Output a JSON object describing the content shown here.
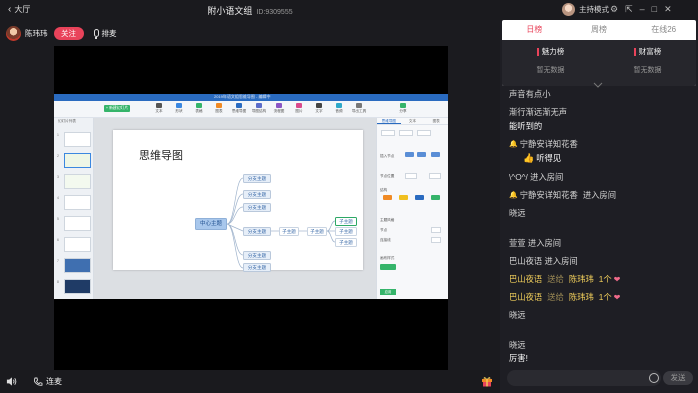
{
  "topbar": {
    "lobby_label": "大厅",
    "room_title": "附小语文组",
    "room_id": "ID:9309555",
    "host_mode_label": "主持模式"
  },
  "anchor": {
    "name": "陈玮玮",
    "follow_label": "关注",
    "mic_queue_label": "排麦"
  },
  "shared_screen": {
    "titlebar_text": "2019年语文组思维导图 - 编辑中",
    "toolbar": [
      "文本",
      "形状",
      "表格",
      "图表",
      "思维导图",
      "导图结构",
      "流程图",
      "图片",
      "文字",
      "音频",
      "导出工具",
      "分享"
    ],
    "new_slide_label": "+ 新建幻灯片",
    "slides_header": "幻灯片列表",
    "slide_numbers": [
      "1",
      "2",
      "3",
      "4",
      "5",
      "6",
      "7",
      "8"
    ],
    "mind_map": {
      "title": "思维导图",
      "center": "中心主题",
      "branches": [
        "分支主题",
        "分支主题",
        "分支主题",
        "分支主题",
        "分支主题",
        "分支主题"
      ],
      "sub_topics": [
        "子主题",
        "子主题",
        "子主题",
        "子主题",
        "子主题"
      ]
    },
    "props_tabs": [
      "思维导图",
      "文本",
      "图表"
    ],
    "props_labels": [
      "插入节点",
      "节点位置",
      "结构",
      "主题风格",
      "节点",
      "连接线",
      "画布样式"
    ],
    "apply_label": "应用"
  },
  "bottombar": {
    "lianmai_label": "连麦"
  },
  "ranking": {
    "tabs": [
      "日榜",
      "周榜",
      "在线26"
    ],
    "active_tab": 0,
    "columns": [
      {
        "title": "魅力榜",
        "empty": "暂无数据"
      },
      {
        "title": "财富榜",
        "empty": "暂无数据"
      }
    ]
  },
  "chat": {
    "messages": [
      {
        "text": "声音有点小",
        "style": "plain"
      },
      {
        "text": "渐行渐远渐无声",
        "style": "plain"
      },
      {
        "text": "能听到的",
        "style": "white"
      },
      {
        "user": "宁静安详知花香",
        "text": "",
        "style": "bell"
      },
      {
        "text": "听得见",
        "style": "thumb"
      },
      {
        "text": "\\^O^/ 进入房间",
        "style": "plain"
      },
      {
        "user": "宁静安详知花香",
        "text": "进入房间",
        "style": "bell"
      },
      {
        "text": "晓远",
        "style": "plain"
      },
      {
        "text": "萱萱 进入房间",
        "style": "plain"
      },
      {
        "text": "巴山夜语 进入房间",
        "style": "plain"
      },
      {
        "user": "巴山夜语",
        "verb": "送给",
        "target": "陈玮玮",
        "count": "1个",
        "style": "gift"
      },
      {
        "user": "巴山夜语",
        "verb": "送给",
        "target": "陈玮玮",
        "count": "1个",
        "style": "gift"
      },
      {
        "text": "晓远",
        "style": "plain"
      },
      {
        "text": "晓远",
        "style": "plain"
      },
      {
        "text": "厉害!",
        "style": "white"
      }
    ],
    "send_label": "发送",
    "input_placeholder": ""
  },
  "colors": {
    "accent": "#e9435a",
    "gift_gold": "#f2cf5b",
    "background": "#1b1b1f"
  }
}
